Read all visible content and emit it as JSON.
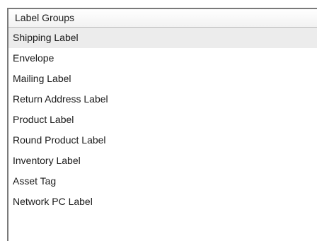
{
  "list": {
    "header": "Label Groups",
    "selected_index": 0,
    "items": [
      {
        "label": "Shipping Label"
      },
      {
        "label": "Envelope"
      },
      {
        "label": "Mailing Label"
      },
      {
        "label": "Return Address Label"
      },
      {
        "label": "Product Label"
      },
      {
        "label": "Round Product Label"
      },
      {
        "label": "Inventory Label"
      },
      {
        "label": "Asset Tag"
      },
      {
        "label": "Network PC Label"
      }
    ]
  }
}
